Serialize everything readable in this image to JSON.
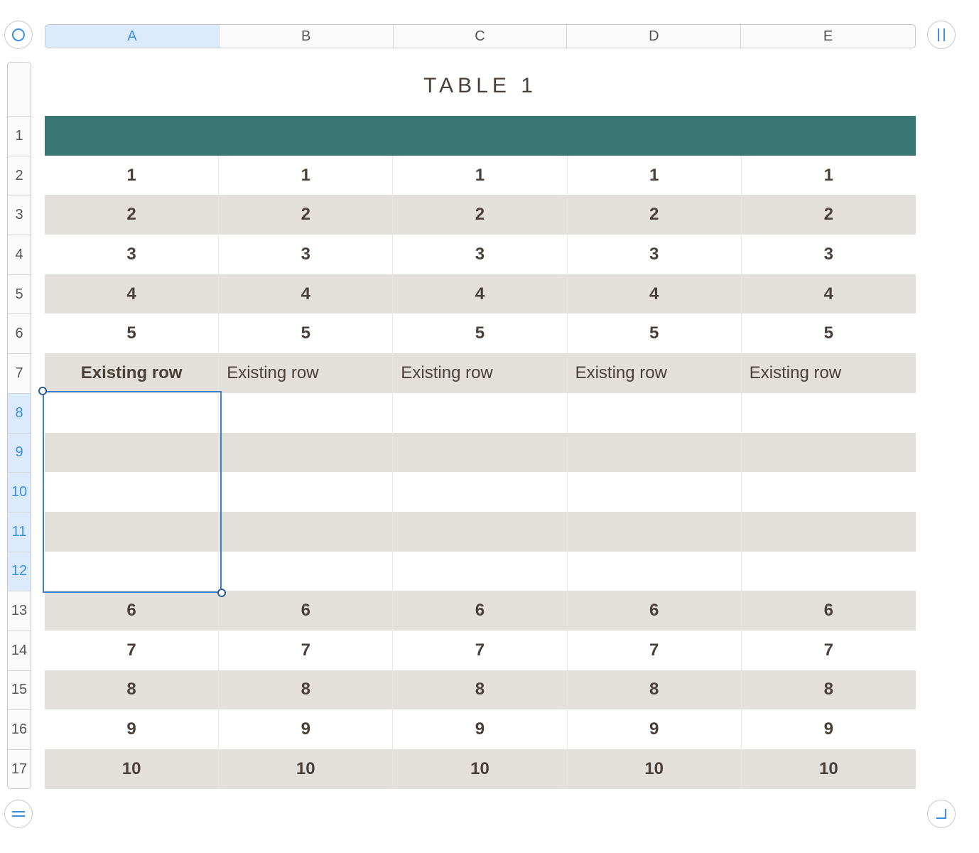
{
  "table": {
    "title": "TABLE 1",
    "columns": [
      "A",
      "B",
      "C",
      "D",
      "E"
    ],
    "selected_column": "A",
    "row_numbers": [
      "1",
      "2",
      "3",
      "4",
      "5",
      "6",
      "7",
      "8",
      "9",
      "10",
      "11",
      "12",
      "13",
      "14",
      "15",
      "16",
      "17"
    ],
    "selected_rows": [
      "8",
      "9",
      "10",
      "11",
      "12"
    ],
    "header_color": "#3a7673",
    "alt_row_color": "#e3e0dc",
    "selection_color": "#3e7fc5",
    "rows": [
      {
        "style": "teal",
        "cells": [
          "",
          "",
          "",
          "",
          ""
        ]
      },
      {
        "style": "white",
        "cells": [
          "1",
          "1",
          "1",
          "1",
          "1"
        ]
      },
      {
        "style": "grey",
        "cells": [
          "2",
          "2",
          "2",
          "2",
          "2"
        ]
      },
      {
        "style": "white",
        "cells": [
          "3",
          "3",
          "3",
          "3",
          "3"
        ]
      },
      {
        "style": "grey",
        "cells": [
          "4",
          "4",
          "4",
          "4",
          "4"
        ]
      },
      {
        "style": "white",
        "cells": [
          "5",
          "5",
          "5",
          "5",
          "5"
        ]
      },
      {
        "style": "grey",
        "cells": [
          "Existing row",
          "Existing row",
          "Existing row",
          "Existing row",
          "Existing row"
        ]
      },
      {
        "style": "white",
        "cells": [
          "",
          "",
          "",
          "",
          ""
        ]
      },
      {
        "style": "grey",
        "cells": [
          "",
          "",
          "",
          "",
          ""
        ]
      },
      {
        "style": "white",
        "cells": [
          "",
          "",
          "",
          "",
          ""
        ]
      },
      {
        "style": "grey",
        "cells": [
          "",
          "",
          "",
          "",
          ""
        ]
      },
      {
        "style": "white",
        "cells": [
          "",
          "",
          "",
          "",
          ""
        ]
      },
      {
        "style": "grey",
        "cells": [
          "6",
          "6",
          "6",
          "6",
          "6"
        ]
      },
      {
        "style": "white",
        "cells": [
          "7",
          "7",
          "7",
          "7",
          "7"
        ]
      },
      {
        "style": "grey",
        "cells": [
          "8",
          "8",
          "8",
          "8",
          "8"
        ]
      },
      {
        "style": "white",
        "cells": [
          "9",
          "9",
          "9",
          "9",
          "9"
        ]
      },
      {
        "style": "grey",
        "cells": [
          "10",
          "10",
          "10",
          "10",
          "10"
        ]
      }
    ]
  },
  "controls": {
    "select_table_icon": "circle-icon",
    "add_column_icon": "column-handle-icon",
    "add_row_icon": "row-handle-icon",
    "resize_icon": "resize-corner-icon"
  }
}
